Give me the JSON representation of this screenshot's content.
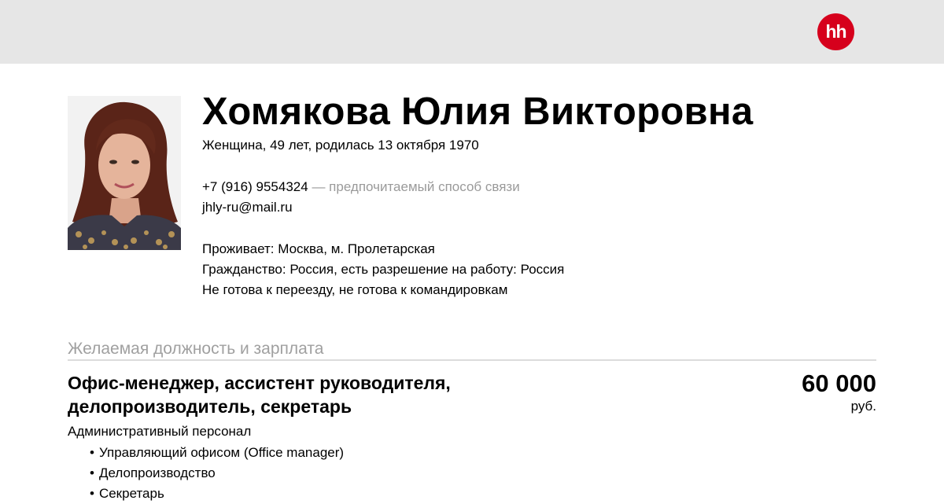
{
  "header": {
    "logo_text": "hh",
    "logo_color": "#d6001c"
  },
  "profile": {
    "name": "Хомякова Юлия Викторовна",
    "gender_age_birth": "Женщина, 49 лет, родилась 13 октября 1970",
    "phone": "+7 (916) 9554324",
    "phone_note": "— предпочитаемый способ связи",
    "email": "jhly-ru@mail.ru",
    "lives": "Проживает: Москва, м. Пролетарская",
    "citizenship": "Гражданство: Россия, есть разрешение на работу: Россия",
    "relocation": "Не готова к переезду, не готова к командировкам"
  },
  "desired": {
    "section_title": "Желаемая должность и зарплата",
    "position_line1": "Офис-менеджер, ассистент руководителя,",
    "position_line2": "делопроизводитель, секретарь",
    "salary": "60 000",
    "currency": "руб.",
    "category": "Административный персонал",
    "specializations": [
      "Управляющий офисом (Office manager)",
      "Делопроизводство",
      "Секретарь"
    ]
  }
}
